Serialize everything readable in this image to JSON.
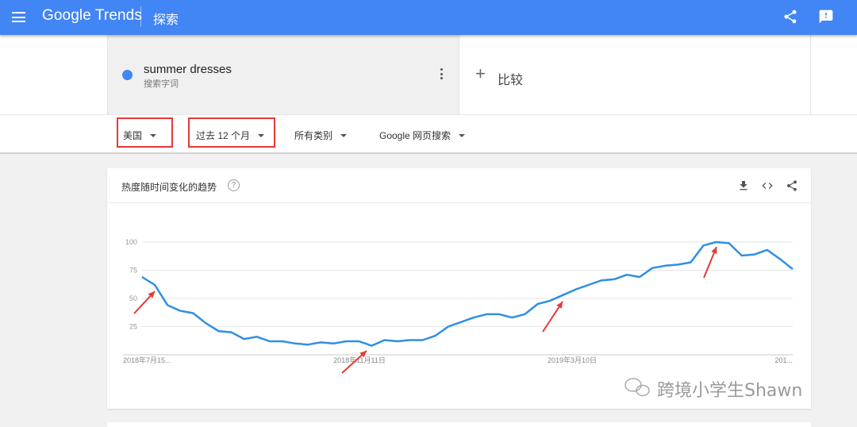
{
  "header": {
    "brand": "Google Trends",
    "page_title": "探索"
  },
  "search_terms": [
    {
      "name": "summer dresses",
      "type": "搜索字词",
      "color": "#4285f4"
    }
  ],
  "compare": {
    "plus": "+",
    "label": "比较"
  },
  "filters": [
    {
      "label": "美国"
    },
    {
      "label": "过去 12 个月"
    },
    {
      "label": "所有类别"
    },
    {
      "label": "Google 网页搜索"
    }
  ],
  "chart_card": {
    "title": "热度随时间变化的趋势",
    "help": "?"
  },
  "colors": {
    "brand_blue": "#4285f4",
    "line": "#2f8fe5",
    "highlight": "#e53935"
  },
  "chart_data": {
    "type": "line",
    "title": "",
    "xlabel": "",
    "ylabel": "",
    "ylim": [
      0,
      100
    ],
    "yticks": [
      25,
      50,
      75,
      100
    ],
    "grid": true,
    "x_tick_labels": [
      "2018年7月15...",
      "2018年11月11日",
      "2019年3月10日",
      "201..."
    ],
    "series": [
      {
        "values": [
          69,
          62,
          44,
          39,
          37,
          28,
          21,
          20,
          14,
          16,
          12,
          12,
          10,
          9,
          11,
          10,
          12,
          12,
          8,
          13,
          12,
          13,
          13,
          17,
          25,
          29,
          33,
          36,
          36,
          33,
          36,
          45,
          48,
          53,
          58,
          62,
          66,
          67,
          71,
          69,
          77,
          79,
          80,
          82,
          97,
          100,
          99,
          88,
          89,
          93,
          85,
          76
        ]
      }
    ],
    "annotations": [
      "red-arrow",
      "red-arrow",
      "red-arrow",
      "red-arrow"
    ]
  },
  "watermark": {
    "text": "跨境小学生Shawn"
  }
}
